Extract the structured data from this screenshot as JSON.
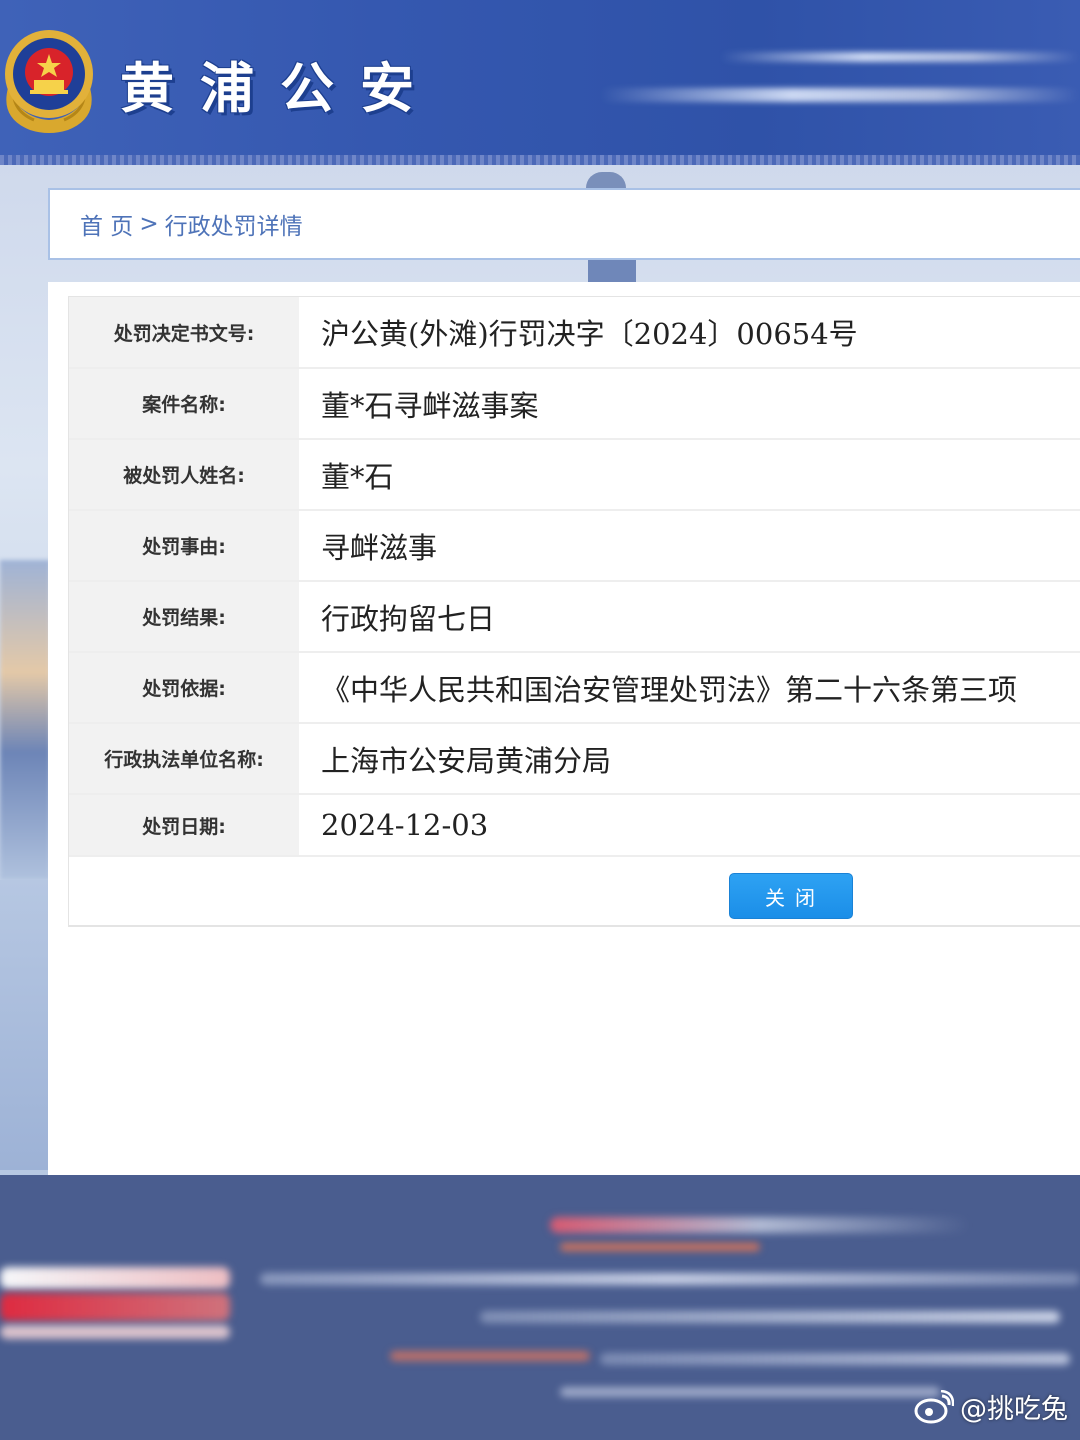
{
  "header": {
    "site_title": "黄浦公安"
  },
  "breadcrumb": {
    "home": "首 页",
    "separator": ">",
    "current": "行政处罚详情"
  },
  "details": {
    "rows": [
      {
        "label": "处罚决定书文号:",
        "value": "沪公黄(外滩)行罚决字〔2024〕00654号"
      },
      {
        "label": "案件名称:",
        "value": "董*石寻衅滋事案"
      },
      {
        "label": "被处罚人姓名:",
        "value": "董*石"
      },
      {
        "label": "处罚事由:",
        "value": "寻衅滋事"
      },
      {
        "label": "处罚结果:",
        "value": "行政拘留七日"
      },
      {
        "label": "处罚依据:",
        "value": "《中华人民共和国治安管理处罚法》第二十六条第三项"
      },
      {
        "label": "行政执法单位名称:",
        "value": "上海市公安局黄浦分局"
      },
      {
        "label": "处罚日期:",
        "value": "2024-12-03"
      }
    ]
  },
  "actions": {
    "close_label": "关闭"
  },
  "watermark": {
    "text": "@挑吃兔"
  },
  "colors": {
    "header_blue": "#3558b0",
    "button_blue": "#1b8ee8",
    "breadcrumb_text": "#4e73b8",
    "label_bg": "#f2f2f2"
  },
  "icons": {
    "emblem": "police-emblem-icon",
    "watermark": "weibo-icon"
  }
}
